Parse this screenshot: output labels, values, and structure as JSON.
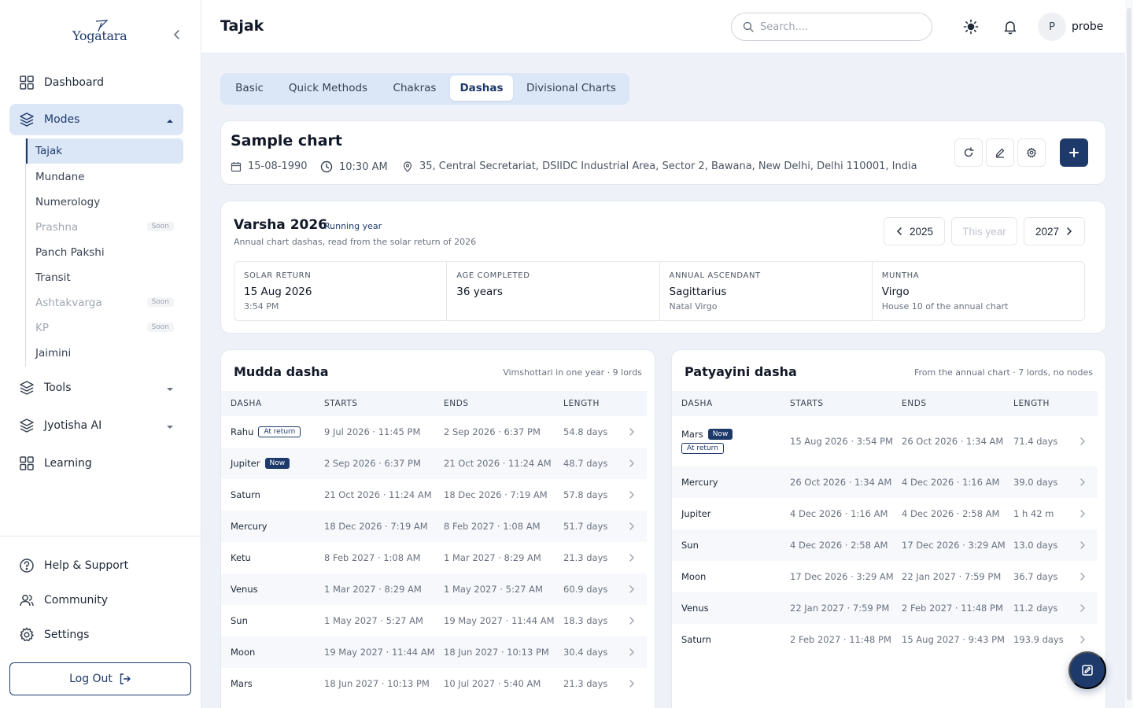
{
  "brand": {
    "name": "Yogatara"
  },
  "sidebar": {
    "dashboard": "Dashboard",
    "modes": "Modes",
    "sub_items": [
      {
        "label": "Tajak",
        "soon": ""
      },
      {
        "label": "Mundane",
        "soon": ""
      },
      {
        "label": "Numerology",
        "soon": ""
      },
      {
        "label": "Prashna",
        "soon": "Soon"
      },
      {
        "label": "Panch Pakshi",
        "soon": ""
      },
      {
        "label": "Transit",
        "soon": ""
      },
      {
        "label": "Ashtakvarga",
        "soon": "Soon"
      },
      {
        "label": "KP",
        "soon": "Soon"
      },
      {
        "label": "Jaimini",
        "soon": ""
      }
    ],
    "tools": "Tools",
    "jyotisha_ai": "Jyotisha AI",
    "learning": "Learning",
    "help": "Help & Support",
    "community": "Community",
    "settings": "Settings",
    "logout": "Log Out"
  },
  "header": {
    "title": "Tajak",
    "search_placeholder": "Search....",
    "avatar_initial": "P",
    "username": "probe"
  },
  "tabs": [
    "Basic",
    "Quick Methods",
    "Chakras",
    "Dashas",
    "Divisional Charts"
  ],
  "active_tab": "Dashas",
  "chart": {
    "name": "Sample chart",
    "date": "15-08-1990",
    "time": "10:30 AM",
    "location": "35, Central Secretariat, DSIIDC Industrial Area, Sector 2, Bawana, New Delhi, Delhi 110001, India"
  },
  "varsha": {
    "title": "Varsha 2026",
    "badge": "Running year",
    "subtitle": "Annual chart dashas, read from the solar return of 2026",
    "prev_year": "2025",
    "this_year": "This year",
    "next_year": "2027",
    "stats": [
      {
        "label": "SOLAR RETURN",
        "value": "15 Aug 2026",
        "sub": "3:54 PM"
      },
      {
        "label": "AGE COMPLETED",
        "value": "36 years",
        "sub": ""
      },
      {
        "label": "ANNUAL ASCENDANT",
        "value": "Sagittarius",
        "sub": "Natal Virgo"
      },
      {
        "label": "MUNTHA",
        "value": "Virgo",
        "sub": "House 10 of the annual chart"
      }
    ]
  },
  "mudda": {
    "title": "Mudda dasha",
    "note": "Vimshottari in one year · 9 lords",
    "columns": [
      "DASHA",
      "STARTS",
      "ENDS",
      "LENGTH"
    ],
    "rows": [
      {
        "lord": "Rahu",
        "now": "",
        "ret": "At return",
        "starts": "9 Jul 2026 · 11:45 PM",
        "ends": "2 Sep 2026 · 6:37 PM",
        "length": "54.8 days"
      },
      {
        "lord": "Jupiter",
        "now": "Now",
        "ret": "",
        "starts": "2 Sep 2026 · 6:37 PM",
        "ends": "21 Oct 2026 · 11:24 AM",
        "length": "48.7 days"
      },
      {
        "lord": "Saturn",
        "now": "",
        "ret": "",
        "starts": "21 Oct 2026 · 11:24 AM",
        "ends": "18 Dec 2026 · 7:19 AM",
        "length": "57.8 days"
      },
      {
        "lord": "Mercury",
        "now": "",
        "ret": "",
        "starts": "18 Dec 2026 · 7:19 AM",
        "ends": "8 Feb 2027 · 1:08 AM",
        "length": "51.7 days"
      },
      {
        "lord": "Ketu",
        "now": "",
        "ret": "",
        "starts": "8 Feb 2027 · 1:08 AM",
        "ends": "1 Mar 2027 · 8:29 AM",
        "length": "21.3 days"
      },
      {
        "lord": "Venus",
        "now": "",
        "ret": "",
        "starts": "1 Mar 2027 · 8:29 AM",
        "ends": "1 May 2027 · 5:27 AM",
        "length": "60.9 days"
      },
      {
        "lord": "Sun",
        "now": "",
        "ret": "",
        "starts": "1 May 2027 · 5:27 AM",
        "ends": "19 May 2027 · 11:44 AM",
        "length": "18.3 days"
      },
      {
        "lord": "Moon",
        "now": "",
        "ret": "",
        "starts": "19 May 2027 · 11:44 AM",
        "ends": "18 Jun 2027 · 10:13 PM",
        "length": "30.4 days"
      },
      {
        "lord": "Mars",
        "now": "",
        "ret": "",
        "starts": "18 Jun 2027 · 10:13 PM",
        "ends": "10 Jul 2027 · 5:40 AM",
        "length": "21.3 days"
      }
    ]
  },
  "patyayini": {
    "title": "Patyayini dasha",
    "note": "From the annual chart · 7 lords, no nodes",
    "columns": [
      "DASHA",
      "STARTS",
      "ENDS",
      "LENGTH"
    ],
    "rows": [
      {
        "lord": "Mars",
        "now": "Now",
        "ret": "At return",
        "starts": "15 Aug 2026 · 3:54 PM",
        "ends": "26 Oct 2026 · 1:34 AM",
        "length": "71.4 days"
      },
      {
        "lord": "Mercury",
        "now": "",
        "ret": "",
        "starts": "26 Oct 2026 · 1:34 AM",
        "ends": "4 Dec 2026 · 1:16 AM",
        "length": "39.0 days"
      },
      {
        "lord": "Jupiter",
        "now": "",
        "ret": "",
        "starts": "4 Dec 2026 · 1:16 AM",
        "ends": "4 Dec 2026 · 2:58 AM",
        "length": "1 h 42 m"
      },
      {
        "lord": "Sun",
        "now": "",
        "ret": "",
        "starts": "4 Dec 2026 · 2:58 AM",
        "ends": "17 Dec 2026 · 3:29 AM",
        "length": "13.0 days"
      },
      {
        "lord": "Moon",
        "now": "",
        "ret": "",
        "starts": "17 Dec 2026 · 3:29 AM",
        "ends": "22 Jan 2027 · 7:59 PM",
        "length": "36.7 days"
      },
      {
        "lord": "Venus",
        "now": "",
        "ret": "",
        "starts": "22 Jan 2027 · 7:59 PM",
        "ends": "2 Feb 2027 · 11:48 PM",
        "length": "11.2 days"
      },
      {
        "lord": "Saturn",
        "now": "",
        "ret": "",
        "starts": "2 Feb 2027 · 11:48 PM",
        "ends": "15 Aug 2027 · 9:43 PM",
        "length": "193.9 days"
      }
    ]
  },
  "colors": {
    "accent": "#1e3a6b",
    "active_bg": "#dbe6f6",
    "page_bg": "#eef2f8"
  }
}
